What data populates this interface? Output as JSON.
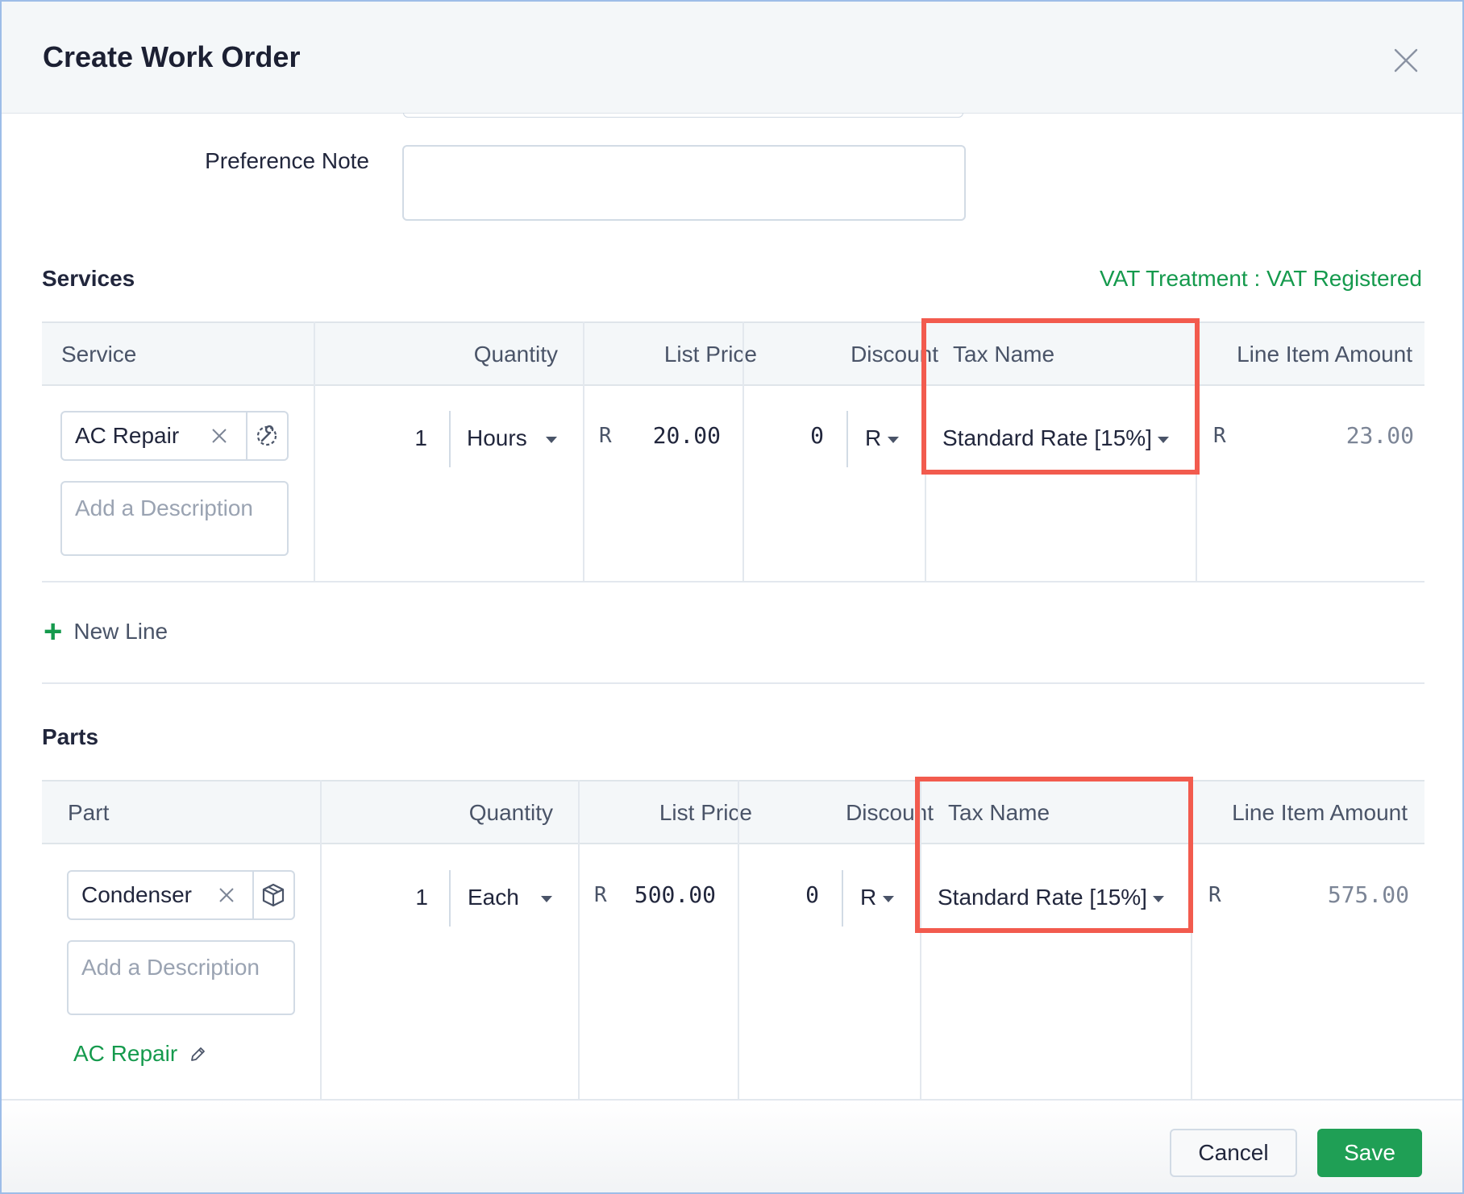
{
  "dialog": {
    "title": "Create Work Order",
    "close_icon": "close-icon"
  },
  "preference_note": {
    "label": "Preference Note",
    "value": ""
  },
  "services": {
    "title": "Services",
    "vat_treatment": "VAT Treatment : VAT Registered",
    "columns": [
      "Service",
      "Quantity",
      "List Price",
      "Discount",
      "Tax Name",
      "Line Item Amount"
    ],
    "rows": [
      {
        "item": "AC Repair",
        "item_icon": "wrench-gear-icon",
        "description_placeholder": "Add a Description",
        "quantity": "1",
        "unit": "Hours",
        "currency": "R",
        "list_price": "20.00",
        "discount": "0",
        "discount_type": "R",
        "tax_name": "Standard Rate [15%]",
        "amount_currency": "R",
        "amount": "23.00"
      }
    ],
    "new_line_label": "New Line"
  },
  "parts": {
    "title": "Parts",
    "columns": [
      "Part",
      "Quantity",
      "List Price",
      "Discount",
      "Tax Name",
      "Line Item Amount"
    ],
    "rows": [
      {
        "item": "Condenser",
        "item_icon": "box-icon",
        "description_placeholder": "Add a Description",
        "linked_service": "AC Repair",
        "quantity": "1",
        "unit": "Each",
        "currency": "R",
        "list_price": "500.00",
        "discount": "0",
        "discount_type": "R",
        "tax_name": "Standard Rate [15%]",
        "amount_currency": "R",
        "amount": "575.00"
      }
    ]
  },
  "footer": {
    "cancel_label": "Cancel",
    "save_label": "Save"
  },
  "colors": {
    "accent_green": "#159a4d",
    "save_button": "#1f9f55",
    "highlight_red": "#f25b4e"
  }
}
